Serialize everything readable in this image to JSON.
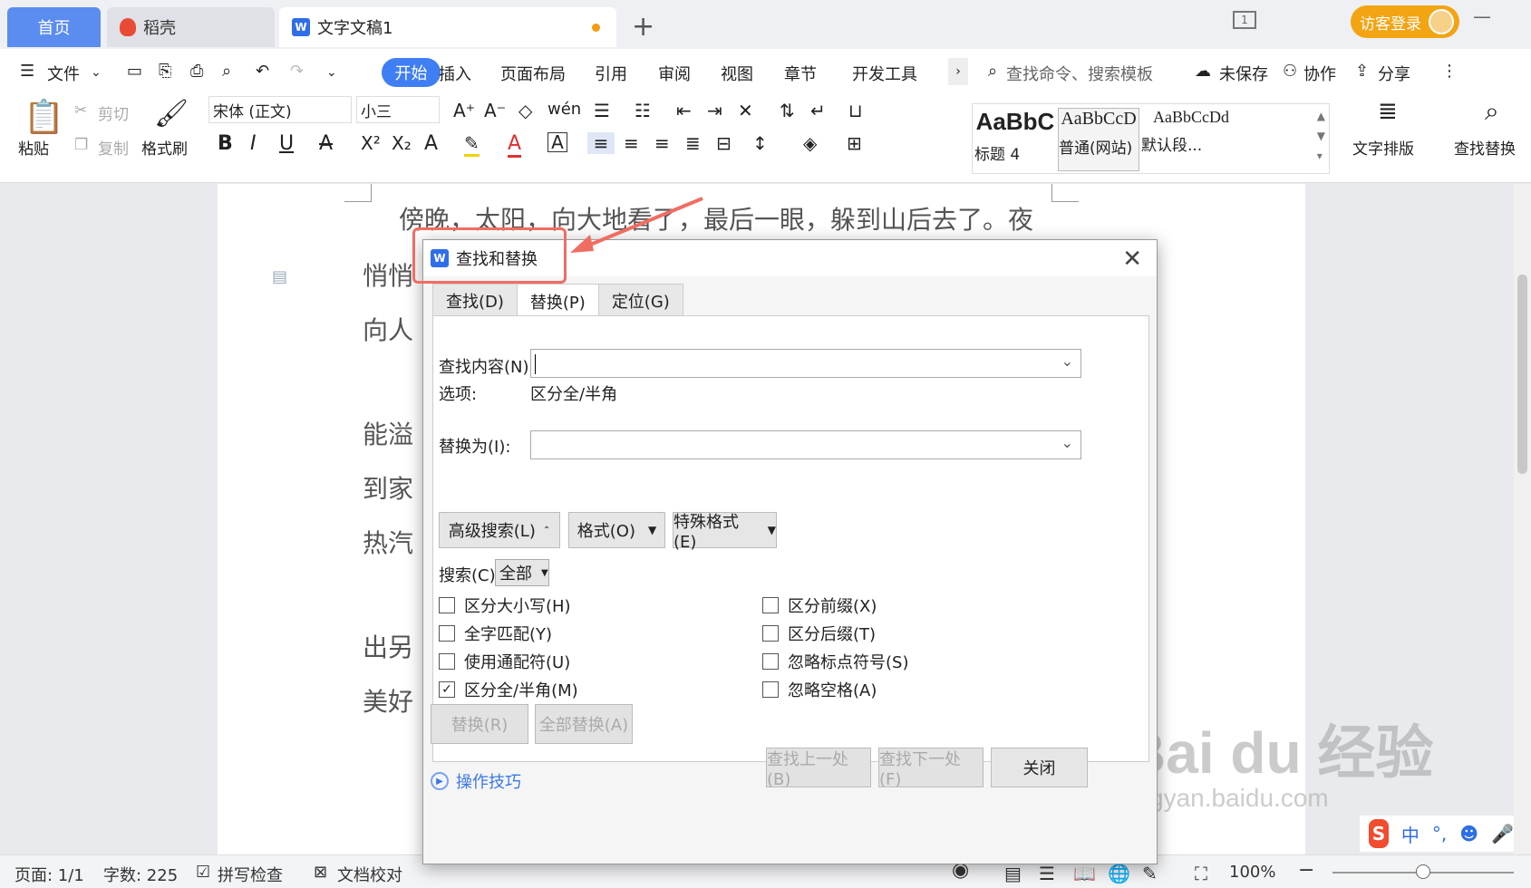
{
  "tabs": {
    "home": "首页",
    "daoke": "稻壳",
    "document": "文字文稿1",
    "new_tab": "+"
  },
  "window": {
    "login": "访客登录",
    "page_count_icon": "1"
  },
  "menu": {
    "file": "文件",
    "start": "开始",
    "insert": "插入",
    "page_layout": "页面布局",
    "reference": "引用",
    "review": "审阅",
    "view": "视图",
    "section": "章节",
    "dev_tools": "开发工具",
    "search_placeholder": "查找命令、搜索模板",
    "unsaved": "未保存",
    "collaborate": "协作",
    "share": "分享"
  },
  "ribbon": {
    "paste": "粘贴",
    "cut": "剪切",
    "copy": "复制",
    "format_painter": "格式刷",
    "font_name": "宋体 (正文)",
    "font_size": "小三",
    "styles": [
      {
        "preview": "AaBbC",
        "label": "标题 4"
      },
      {
        "preview": "AaBbCcD",
        "label": "普通(网站)"
      },
      {
        "preview": "AaBbCcDd",
        "label": "默认段..."
      }
    ],
    "text_layout": "文字排版",
    "find_replace": "查找替换"
  },
  "document": {
    "lines": [
      "傍晚，太阳，向大地看了，最后一眼，躲到山后去了。夜",
      "悄悄",
      "向人",
      "能溢",
      "到家",
      "热汽",
      "出另",
      "美好"
    ]
  },
  "dialog": {
    "title": "查找和替换",
    "tabs": [
      "查找(D)",
      "替换(P)",
      "定位(G)"
    ],
    "find_label": "查找内容(N):",
    "find_value": "",
    "options_label": "选项:",
    "options_value": "区分全/半角",
    "replace_label": "替换为(I):",
    "replace_value": "",
    "advanced_search": "高级搜索(L)",
    "format": "格式(O)",
    "special_format": "特殊格式(E)",
    "search_label": "搜索(C)",
    "search_scope": "全部",
    "checkboxes_left": [
      {
        "label": "区分大小写(H)",
        "checked": false
      },
      {
        "label": "全字匹配(Y)",
        "checked": false
      },
      {
        "label": "使用通配符(U)",
        "checked": false
      },
      {
        "label": "区分全/半角(M)",
        "checked": true
      }
    ],
    "checkboxes_right": [
      {
        "label": "区分前缀(X)",
        "checked": false
      },
      {
        "label": "区分后缀(T)",
        "checked": false
      },
      {
        "label": "忽略标点符号(S)",
        "checked": false
      },
      {
        "label": "忽略空格(A)",
        "checked": false
      }
    ],
    "replace_btn": "替换(R)",
    "replace_all_btn": "全部替换(A)",
    "tips": "操作技巧",
    "find_prev": "查找上一处(B)",
    "find_next": "查找下一处(F)",
    "close": "关闭"
  },
  "status": {
    "page": "页面: 1/1",
    "words": "字数: 225",
    "spell_check": "拼写检查",
    "doc_proof": "文档校对",
    "zoom": "100%"
  },
  "watermark": {
    "brand": "Bai du 经验",
    "url": "jingyan.baidu.com"
  },
  "ime": {
    "mode": "中"
  },
  "colors": {
    "accent": "#3f7ef3",
    "home_tab": "#5b8cf0",
    "login": "#f3a413",
    "annotation": "#f06d62"
  }
}
